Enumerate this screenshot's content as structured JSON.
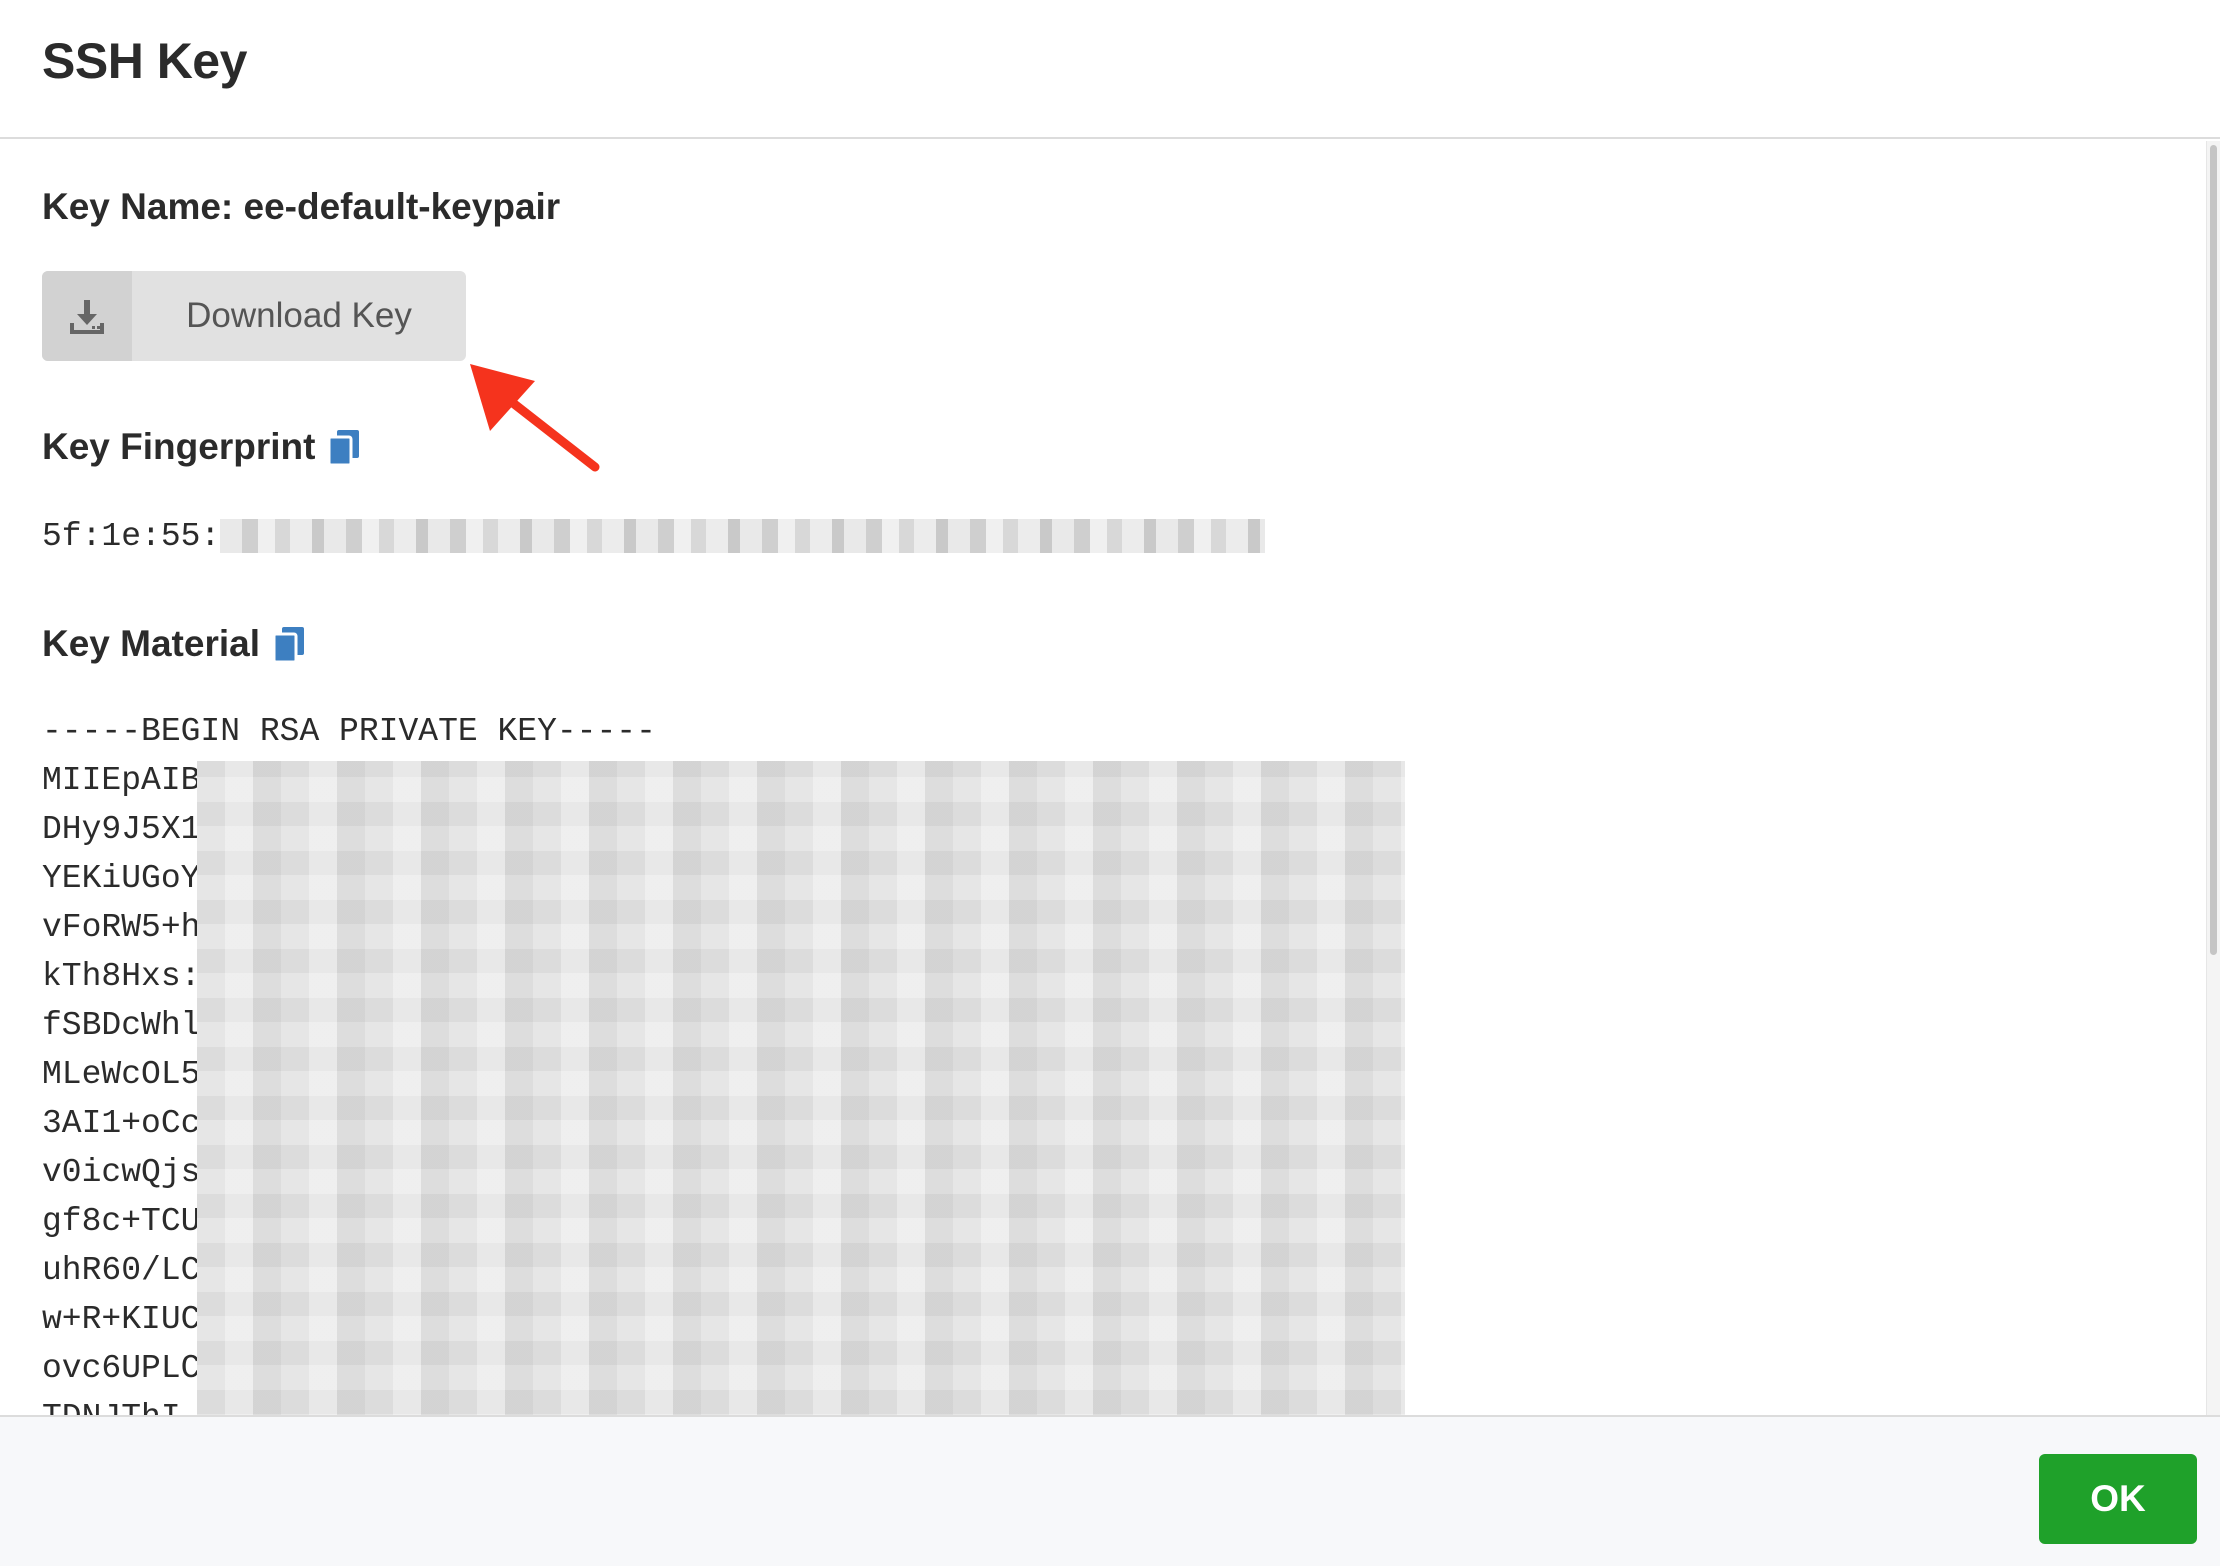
{
  "modal": {
    "title": "SSH Key"
  },
  "key": {
    "name_label": "Key Name: ee-default-keypair",
    "download_label": "Download Key",
    "fingerprint_label": "Key Fingerprint",
    "fingerprint_visible": "5f:1e:55:",
    "material_label": "Key Material",
    "material_lines": [
      "-----BEGIN RSA PRIVATE KEY-----",
      "MIIEpAIB",
      "DHy9J5X1",
      "YEKiUGoY",
      "vFoRW5+h",
      "kTh8Hxs:",
      "fSBDcWhl",
      "MLeWcOL5",
      "3AI1+oCc",
      "v0icwQjs",
      "gf8c+TCU",
      "uhR60/LC",
      "w+R+KIUC",
      "ovc6UPLC",
      "TDNJThI"
    ]
  },
  "footer": {
    "ok_label": "OK"
  },
  "icons": {
    "download": "download-icon",
    "copy": "copy-icon",
    "annotation": "red-arrow-annotation"
  },
  "colors": {
    "ok_button": "#1fa12a",
    "copy_icon": "#3d7fc1",
    "arrow": "#f5331d"
  }
}
